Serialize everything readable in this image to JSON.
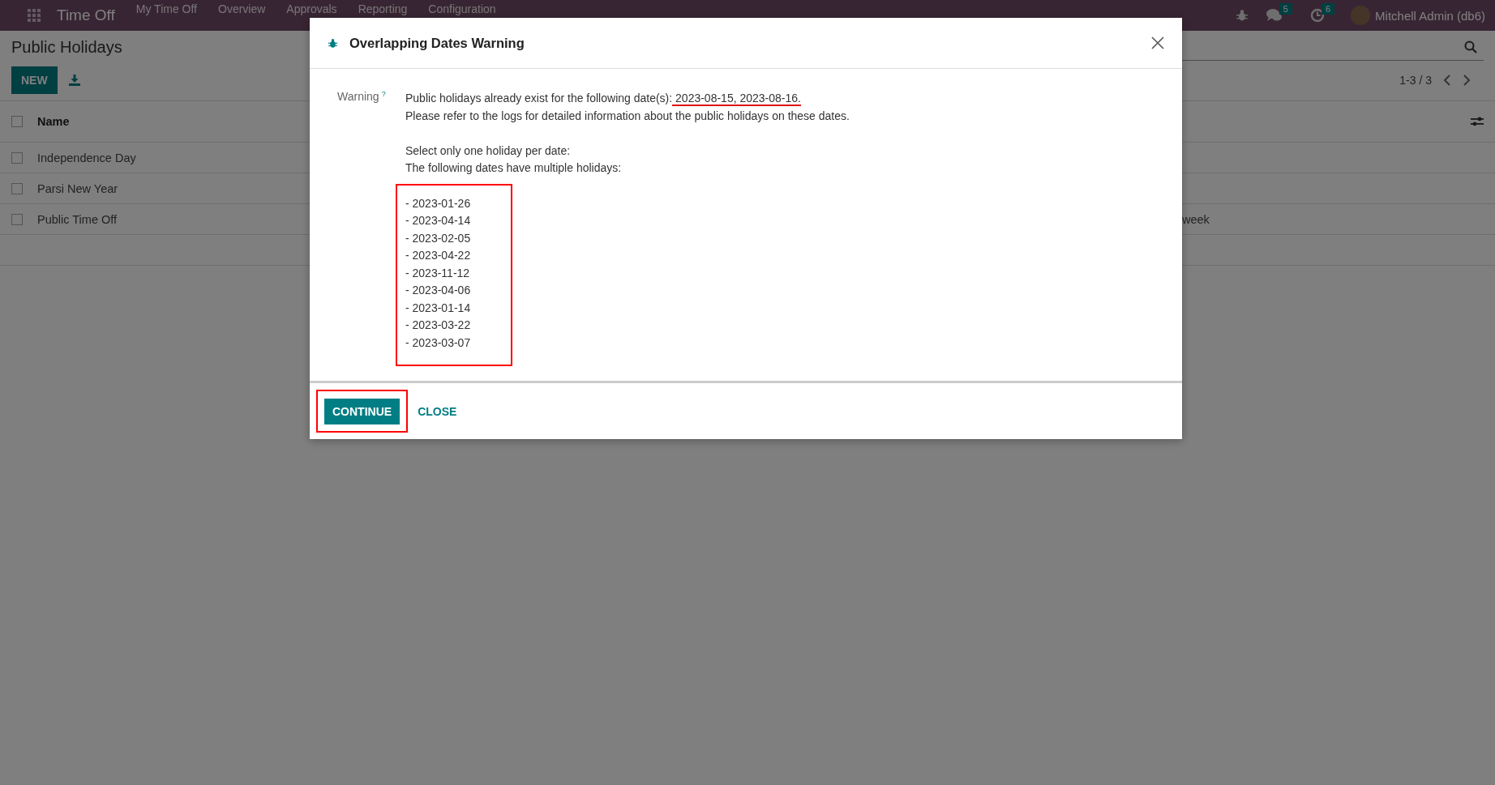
{
  "navbar": {
    "app_name": "Time Off",
    "menu": [
      "My Time Off",
      "Overview",
      "Approvals",
      "Reporting",
      "Configuration"
    ],
    "messages_count": "5",
    "activities_count": "6",
    "user": "Mitchell Admin (db6)"
  },
  "control_panel": {
    "title": "Public Holidays",
    "new_button": "NEW",
    "pager": "1-3 / 3"
  },
  "table": {
    "columns": [
      "Name"
    ],
    "header_checked": false,
    "rows": [
      {
        "name": "Independence Day",
        "checked": false
      },
      {
        "name": "Parsi New Year",
        "checked": false
      },
      {
        "name": "Public Time Off",
        "checked": false,
        "column_2": "week"
      }
    ]
  },
  "dialog": {
    "title": "Overlapping Dates Warning",
    "field_label": "Warning",
    "help_mark": "?",
    "message_start": "Public holidays already exist for the following date(s):",
    "message_dates": " 2023-08-15, 2023-08-16.",
    "message_line2": "Please refer to the logs for detailed information about the public holidays on these dates.",
    "instruction": "Select only one holiday per date:",
    "list_intro": "The following dates have multiple holidays:",
    "dates": [
      "- 2023-01-26",
      "- 2023-04-14",
      "- 2023-02-05",
      "- 2023-04-22",
      "- 2023-11-12",
      "- 2023-04-06",
      "- 2023-01-14",
      "- 2023-03-22",
      "- 2023-03-07"
    ],
    "buttons": [
      {
        "label": "CONTINUE",
        "kind": "primary"
      },
      {
        "label": "CLOSE",
        "kind": "link"
      }
    ]
  }
}
